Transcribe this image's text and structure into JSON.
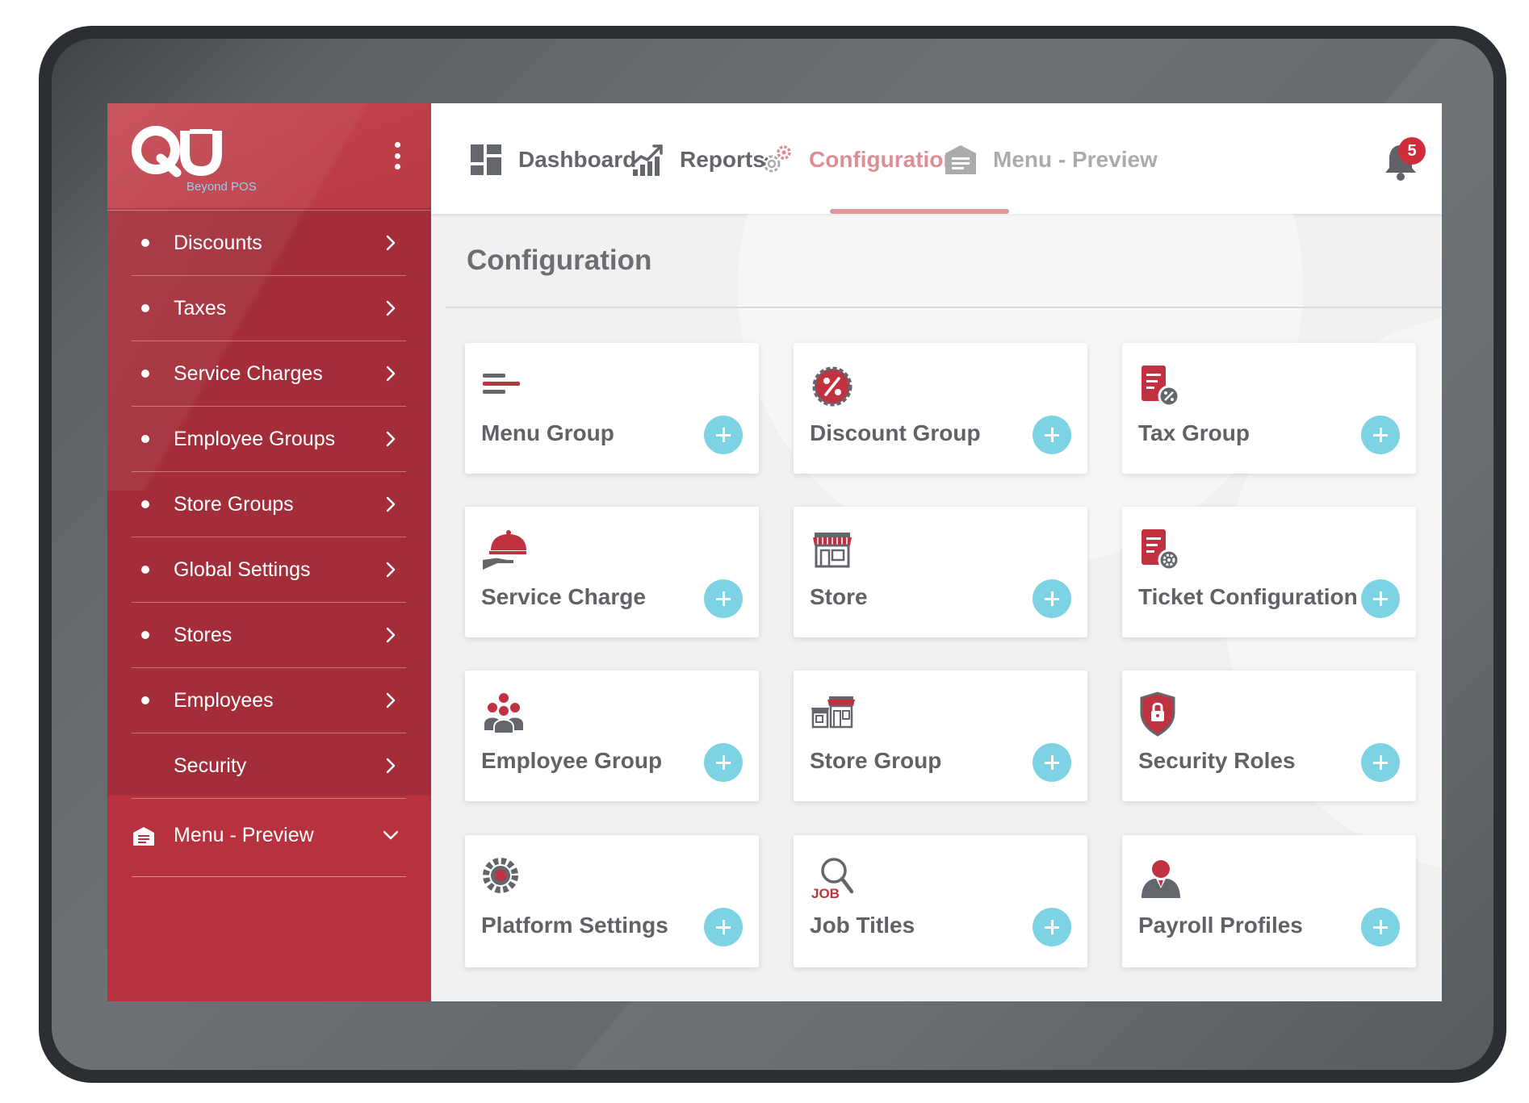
{
  "app": {
    "logo_text": "QU",
    "logo_subtitle": "Beyond POS"
  },
  "sidebar": {
    "items": [
      {
        "label": "Discounts",
        "bullet": true
      },
      {
        "label": "Taxes",
        "bullet": true
      },
      {
        "label": "Service Charges",
        "bullet": true
      },
      {
        "label": "Employee Groups",
        "bullet": true
      },
      {
        "label": "Store Groups",
        "bullet": true
      },
      {
        "label": "Global Settings",
        "bullet": true
      },
      {
        "label": "Stores",
        "bullet": true
      },
      {
        "label": "Employees",
        "bullet": true
      },
      {
        "label": "Security",
        "bullet": false
      }
    ],
    "preview": {
      "label": "Menu - Preview",
      "icon": "menu-preview-icon"
    }
  },
  "topnav": {
    "items": [
      {
        "label": "Dashboard",
        "icon": "dashboard-icon",
        "active": false
      },
      {
        "label": "Reports",
        "icon": "reports-icon",
        "active": false
      },
      {
        "label": "Configuration",
        "icon": "configuration-icon",
        "active": true
      },
      {
        "label": "Menu - Preview",
        "icon": "menu-preview-icon",
        "active": false
      }
    ],
    "notifications_count": "5"
  },
  "main": {
    "title": "Configuration",
    "cards": [
      {
        "label": "Menu Group",
        "icon": "menu-group-icon"
      },
      {
        "label": "Discount Group",
        "icon": "discount-group-icon"
      },
      {
        "label": "Tax Group",
        "icon": "tax-group-icon"
      },
      {
        "label": "Service Charge",
        "icon": "service-charge-icon"
      },
      {
        "label": "Store",
        "icon": "store-icon"
      },
      {
        "label": "Ticket Configuration",
        "icon": "ticket-configuration-icon"
      },
      {
        "label": "Employee Group",
        "icon": "employee-group-icon"
      },
      {
        "label": "Store Group",
        "icon": "store-group-icon"
      },
      {
        "label": "Security Roles",
        "icon": "security-roles-icon"
      },
      {
        "label": "Platform Settings",
        "icon": "platform-settings-icon"
      },
      {
        "label": "Job Titles",
        "icon": "job-titles-icon",
        "icon_text": "JOB"
      },
      {
        "label": "Payroll Profiles",
        "icon": "payroll-profiles-icon"
      }
    ]
  },
  "colors": {
    "brand_red": "#c0323f",
    "sidebar_red": "#a32d38",
    "accent_cyan": "#7dd3e3",
    "icon_gray": "#5f6267"
  }
}
